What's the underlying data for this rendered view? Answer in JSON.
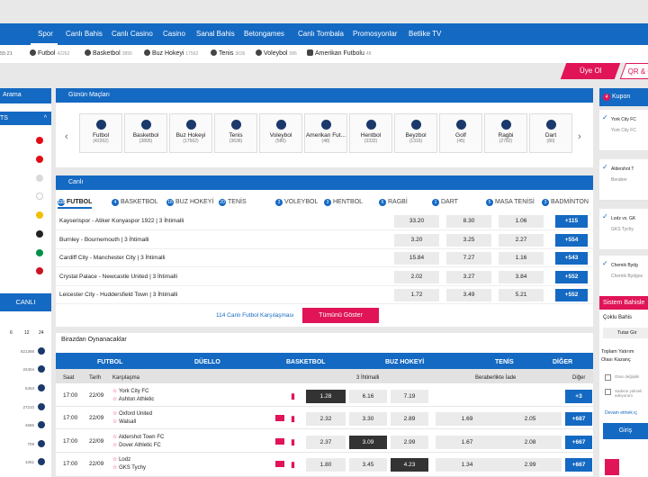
{
  "top_nav": [
    "Spor",
    "Canlı Bahis",
    "Canlı Casino",
    "Casino",
    "Sanal Bahis",
    "Betongames",
    "Canlı Tombala",
    "Promosyonlar",
    "Betlike TV"
  ],
  "time": "55:21",
  "sports_strip": [
    {
      "name": "Futbol",
      "count": "42262"
    },
    {
      "name": "Basketbol",
      "count": "3895"
    },
    {
      "name": "Buz Hokeyi",
      "count": "17562"
    },
    {
      "name": "Tenis",
      "count": "3636"
    },
    {
      "name": "Voleybol",
      "count": "586"
    },
    {
      "name": "Amerikan Futbolu",
      "count": "48"
    }
  ],
  "auth": {
    "register": "Üye Ol",
    "qr": "QR & G"
  },
  "left": {
    "search": "Arama",
    "list_header": "TS",
    "list_caret": "^",
    "canli": "CANLI",
    "time_cols": [
      "6",
      "12",
      "24"
    ],
    "counts": [
      "821368",
      "22404",
      "5453",
      "27210",
      "4686",
      "709",
      "1061"
    ],
    "flags": [
      "#e30a17",
      "#e30a17",
      "#d9d9d9",
      "#ffffff",
      "#f1bf00",
      "#222222",
      "#009246",
      "#ce1126"
    ]
  },
  "gunun": {
    "title": "Günün Maçları",
    "tiles": [
      {
        "name": "Futbol",
        "count": "(42262)"
      },
      {
        "name": "Basketbol",
        "count": "(3895)"
      },
      {
        "name": "Buz Hokeyi",
        "count": "(17562)"
      },
      {
        "name": "Tenis",
        "count": "(3636)"
      },
      {
        "name": "Voleybol",
        "count": "(586)"
      },
      {
        "name": "Amerikan Fut...",
        "count": "(48)"
      },
      {
        "name": "Hentbol",
        "count": "(3332)"
      },
      {
        "name": "Beyzbol",
        "count": "(1316)"
      },
      {
        "name": "Golf",
        "count": "(45)"
      },
      {
        "name": "Ragbi",
        "count": "(2782)"
      },
      {
        "name": "Dart",
        "count": "(80)"
      }
    ]
  },
  "canli": {
    "title": "Canlı",
    "tabs": [
      {
        "label": "FUTBOL",
        "badge": "115"
      },
      {
        "label": "BASKETBOL",
        "badge": "4"
      },
      {
        "label": "BUZ HOKEYİ",
        "badge": "18"
      },
      {
        "label": "TENİS",
        "badge": "20"
      },
      {
        "label": "VOLEYBOL",
        "badge": "3"
      },
      {
        "label": "HENTBOL",
        "badge": "3"
      },
      {
        "label": "RAGBİ",
        "badge": "6"
      },
      {
        "label": "DART",
        "badge": "1"
      },
      {
        "label": "MASA TENİSİ",
        "badge": "5"
      },
      {
        "label": "BADMİNTON",
        "badge": "3"
      }
    ],
    "matches": [
      {
        "name": "Kayserispor - Atiker Konyaspor 1922 | 3 İhtimalli",
        "score": "0:2",
        "odds": [
          "33.20",
          "8.30",
          "1.06"
        ],
        "more": "+115"
      },
      {
        "name": "Burnley - Bournemouth | 3 İhtimalli",
        "score": "-:-",
        "odds": [
          "3.20",
          "3.25",
          "2.27"
        ],
        "more": "+554"
      },
      {
        "name": "Cardiff City - Manchester City | 3 İhtimalli",
        "score": "-:-",
        "odds": [
          "15.84",
          "7.27",
          "1.16"
        ],
        "more": "+543"
      },
      {
        "name": "Crystal Palace - Newcastle United | 3 İhtimalli",
        "score": "-:-",
        "odds": [
          "2.02",
          "3.27",
          "3.84"
        ],
        "more": "+552"
      },
      {
        "name": "Leicester City - Huddersfield Town | 3 İhtimalli",
        "score": "-:-",
        "odds": [
          "1.72",
          "3.49",
          "5.21"
        ],
        "more": "+552"
      }
    ],
    "footer_text": "114 Canlı Futbol Karşılaşması",
    "show_all": "Tümünü Göster"
  },
  "upcoming": {
    "title": "Birazdan Oynanacaklar",
    "tabs": [
      "FUTBOL",
      "DÜELLO",
      "BASKETBOL",
      "BUZ HOKEYİ",
      "TENİS",
      "DİĞER"
    ],
    "headers": {
      "saat": "Saat",
      "tarih": "Tarih",
      "karsilasma": "Karşılaşma",
      "ihtimal": "3 İhtimalli",
      "beraber": "Beraberlikte İade",
      "diger": "Diğer"
    },
    "rows": [
      {
        "time": "17:00",
        "date": "22/09",
        "home": "York City FC",
        "away": "Ashton Athletic",
        "odds": [
          "1.28",
          "6.16",
          "7.19"
        ],
        "draw": [],
        "more": "+3"
      },
      {
        "time": "17:00",
        "date": "22/09",
        "home": "Oxford United",
        "away": "Walsall",
        "odds": [
          "2.32",
          "3.30",
          "2.89"
        ],
        "draw": [
          "1.69",
          "2.05"
        ],
        "more": "+687"
      },
      {
        "time": "17:00",
        "date": "22/09",
        "home": "Aldershot Town FC",
        "away": "Dover Athletic FC",
        "odds": [
          "2.37",
          "3.09",
          "2.99"
        ],
        "draw": [
          "1.67",
          "2.08"
        ],
        "more": "+667"
      },
      {
        "time": "17:00",
        "date": "22/09",
        "home": "Lodz",
        "away": "GKS Tychy",
        "odds": [
          "1.80",
          "3.45",
          "4.23"
        ],
        "draw": [
          "1.34",
          "2.99"
        ],
        "more": "+667"
      }
    ]
  },
  "right": {
    "kupon": "Kupon",
    "kupon_badge": "4",
    "kupon_items": [
      {
        "team": "York City FC",
        "sub": "York City FC"
      },
      {
        "team": "Aldershot T",
        "sub": "Beraber"
      },
      {
        "team": "Lodz vs. GK",
        "sub": "GKS Tychy"
      },
      {
        "team": "Chemik Bydg",
        "sub": "Chemik Bydgos"
      }
    ],
    "system": "Sistem Bahisle",
    "coklu": "Çoklu Bahis",
    "tutar": "Tutar Gir",
    "toplam": "Toplam Yatırım",
    "olasi": "Olası Kazanç",
    "opt1": "Oran değişikli",
    "opt2": "Sadece yükseli edeyorum",
    "devam": "Devam etmek iç",
    "giris": "Giriş"
  },
  "colors": {
    "primary": "#1469c2",
    "accent": "#e01457",
    "dark": "#333333"
  }
}
